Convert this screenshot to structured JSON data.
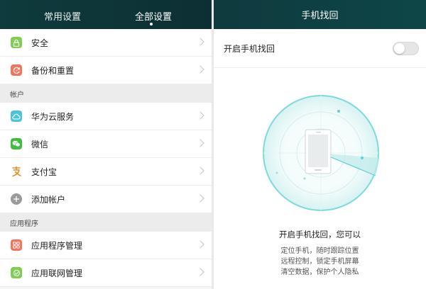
{
  "left_panel": {
    "tabs": {
      "common": "常用设置",
      "all": "全部设置"
    },
    "rows_top": [
      {
        "label": "安全",
        "icon": "lock-icon",
        "color": "#7fce52"
      },
      {
        "label": "备份和重置",
        "icon": "backup-icon",
        "color": "#f2745a"
      }
    ],
    "section_accounts": "帐户",
    "rows_accounts": [
      {
        "label": "华为云服务",
        "icon": "cloud-icon",
        "color": "#4cc3d9"
      },
      {
        "label": "微信",
        "icon": "wechat-icon",
        "color": "#3fbf3f"
      },
      {
        "label": "支付宝",
        "icon": "alipay-icon",
        "color": "#f5a623"
      },
      {
        "label": "添加帐户",
        "icon": "plus-icon",
        "color": "#9b9b9b"
      }
    ],
    "section_apps": "应用程序",
    "rows_apps": [
      {
        "label": "应用程序管理",
        "icon": "grid-icon",
        "color": "#f2745a"
      },
      {
        "label": "应用联网管理",
        "icon": "network-icon",
        "color": "#7fce52"
      }
    ]
  },
  "right_panel": {
    "title": "手机找回",
    "toggle": {
      "label": "开启手机找回",
      "state": "off"
    },
    "desc_title": "开启手机找回，您可以",
    "desc_lines": [
      "定位手机，随时跟踪位置",
      "远程控制，锁定手机屏幕",
      "清空数据，保护个人隐私"
    ],
    "accent_color": "#5fd1d4"
  }
}
